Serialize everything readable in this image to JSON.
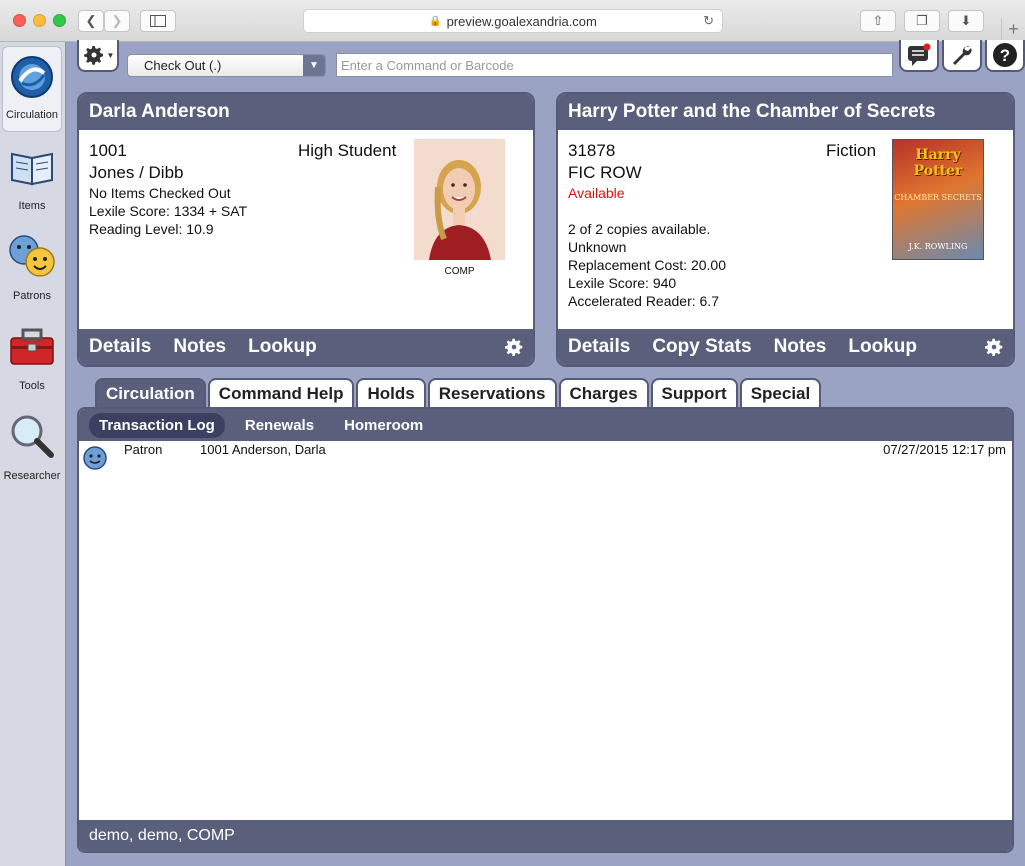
{
  "browser": {
    "url": "preview.goalexandria.com"
  },
  "sidebar": {
    "items": [
      {
        "label": "Circulation"
      },
      {
        "label": "Items"
      },
      {
        "label": "Patrons"
      },
      {
        "label": "Tools"
      },
      {
        "label": "Researcher"
      }
    ]
  },
  "toolbar": {
    "mode": "Check Out (.)",
    "command_placeholder": "Enter a Command or Barcode"
  },
  "patron": {
    "name": "Darla Anderson",
    "barcode": "1001",
    "grade": "High Student",
    "homeroom": "Jones / Dibb",
    "checked_out": "No Items Checked Out",
    "lexile": "Lexile Score: 1334 + SAT",
    "reading_level": "Reading Level: 10.9",
    "photo_caption": "COMP",
    "actions": [
      "Details",
      "Notes",
      "Lookup"
    ]
  },
  "item": {
    "title": "Harry Potter and the Chamber of Secrets",
    "barcode": "31878",
    "call_number": "FIC ROW",
    "status": "Available",
    "genre": "Fiction",
    "copies": "2 of 2 copies available.",
    "condition": "Unknown",
    "replacement": "Replacement Cost: 20.00",
    "lexile": "Lexile Score: 940",
    "ar": "Accelerated Reader: 6.7",
    "cover_title": "Harry Potter",
    "cover_sub": "CHAMBER SECRETS",
    "cover_author": "J.K. ROWLING",
    "actions": [
      "Details",
      "Copy Stats",
      "Notes",
      "Lookup"
    ]
  },
  "tabs": [
    "Circulation",
    "Command Help",
    "Holds",
    "Reservations",
    "Charges",
    "Support",
    "Special"
  ],
  "subtabs": [
    "Transaction Log",
    "Renewals",
    "Homeroom"
  ],
  "log": {
    "rows": [
      {
        "type": "Patron",
        "detail": "1001 Anderson, Darla",
        "time": "07/27/2015 12:17 pm"
      }
    ],
    "footer": "demo, demo, COMP"
  },
  "colors": {
    "panel": "#5a607c",
    "available": "#e01010",
    "background": "#9aa3c4"
  }
}
